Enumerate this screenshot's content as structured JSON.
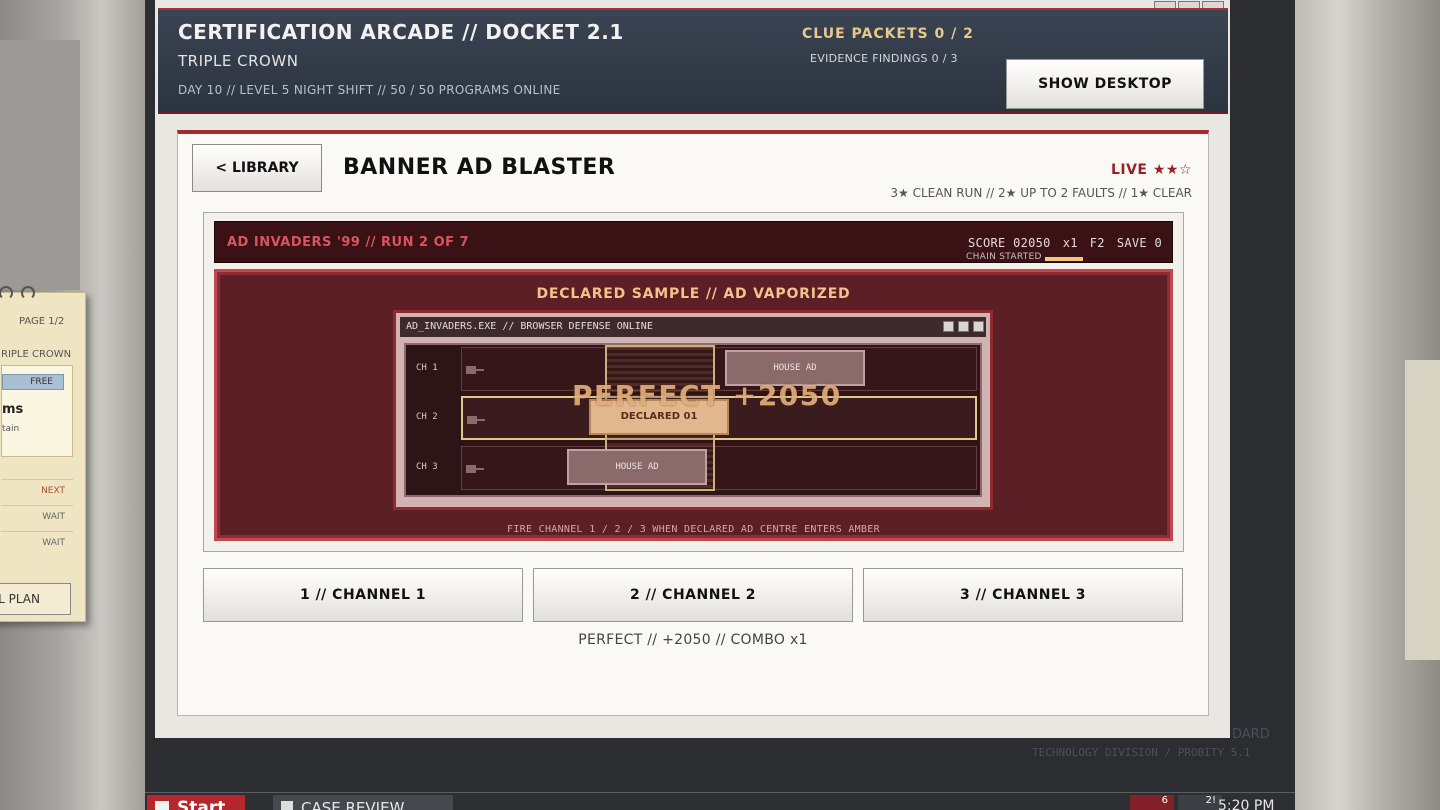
{
  "header": {
    "title": "CERTIFICATION ARCADE // DOCKET 2.1",
    "subtitle": "TRIPLE CROWN",
    "status_line": "DAY 10 // LEVEL 5 NIGHT SHIFT // 50 / 50 PROGRAMS ONLINE",
    "clue_packets": "CLUE PACKETS 0 / 2",
    "evidence_findings": "EVIDENCE FINDINGS 0 / 3",
    "show_desktop_label": "SHOW DESKTOP"
  },
  "card": {
    "library_label": "< LIBRARY",
    "game_title": "BANNER AD BLASTER",
    "live_label": "LIVE ★★☆",
    "live_stars": 2,
    "rules": "3★ CLEAN RUN  //  2★ UP TO 2 FAULTS  //  1★ CLEAR"
  },
  "game": {
    "bar_title": "AD INVADERS '99 // RUN 2 OF 7",
    "score": "SCORE  02050",
    "multiplier": "x1",
    "faults": "F2",
    "save": "SAVE  0",
    "chain_label": "CHAIN STARTED",
    "chain_progress_fraction": 0.4,
    "declared_banner": "DECLARED SAMPLE // AD VAPORIZED",
    "window_title": "AD_INVADERS.EXE // BROWSER DEFENSE ONLINE",
    "channels": [
      {
        "label": "CH 1",
        "ad": "HOUSE AD"
      },
      {
        "label": "CH 2",
        "ad": "DECLARED 01"
      },
      {
        "label": "CH 3",
        "ad": "HOUSE AD"
      }
    ],
    "popup": "PERFECT  +2050",
    "hint": "FIRE CHANNEL 1 / 2 / 3 WHEN DECLARED AD CENTRE ENTERS AMBER"
  },
  "buttons": [
    {
      "label": "1 // CHANNEL 1"
    },
    {
      "label": "2 // CHANNEL 2"
    },
    {
      "label": "3 // CHANNEL 3"
    }
  ],
  "result_text": "PERFECT // +2050 // COMBO x1",
  "notepad": {
    "page": "PAGE 1/2",
    "crown": "RIPLE CROWN",
    "free": "FREE",
    "ms": "ms",
    "tain": "tain",
    "rows": [
      "NEXT",
      "WAIT",
      "WAIT"
    ],
    "plan_button": "LL PLAN"
  },
  "watermark": {
    "line1": "DARD",
    "line2": "TECHNOLOGY DIVISION  /  PROBITY 5.1"
  },
  "taskbar": {
    "start_label": "Start",
    "task_label": "CASE REVIEW",
    "badge1": "6",
    "badge2": "2!",
    "clock": "5:20 PM"
  },
  "colors": {
    "accent_red": "#a52a30",
    "header_bg": "#2c3440",
    "clue_gold": "#e7c98a",
    "game_bg": "#5b1f25"
  }
}
